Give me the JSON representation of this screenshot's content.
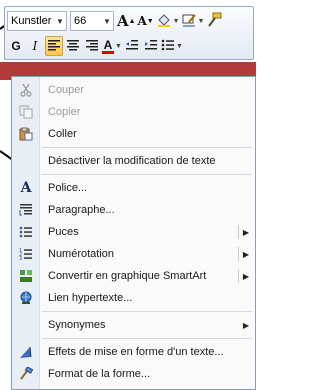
{
  "toolbar": {
    "font_name": "Kunstler",
    "font_size": "66",
    "grow_font": "A",
    "shrink_font": "A",
    "bold": "G",
    "italic": "I",
    "font_color_label": "A"
  },
  "menu": {
    "items": [
      {
        "label": "Couper",
        "icon": "scissors-icon",
        "disabled": true
      },
      {
        "label": "Copier",
        "icon": "copy-icon",
        "disabled": true
      },
      {
        "label": "Coller",
        "icon": "paste-icon",
        "disabled": false
      },
      {
        "label": "Désactiver la modification de texte",
        "icon": "",
        "disabled": false
      },
      {
        "label": "Police...",
        "icon": "font-icon",
        "disabled": false
      },
      {
        "label": "Paragraphe...",
        "icon": "paragraph-icon",
        "disabled": false
      },
      {
        "label": "Puces",
        "icon": "bullets-icon",
        "disabled": false,
        "submenu": true
      },
      {
        "label": "Numérotation",
        "icon": "numbering-icon",
        "disabled": false,
        "submenu": true
      },
      {
        "label": "Convertir en graphique SmartArt",
        "icon": "smartart-icon",
        "disabled": false,
        "submenu": true
      },
      {
        "label": "Lien hypertexte...",
        "icon": "hyperlink-icon",
        "disabled": false
      },
      {
        "label": "Synonymes",
        "icon": "",
        "disabled": false,
        "submenu": true
      },
      {
        "label": "Effets de mise en forme d'un texte...",
        "icon": "text-effects-icon",
        "disabled": false
      },
      {
        "label": "Format de la forme...",
        "icon": "format-shape-icon",
        "disabled": false
      }
    ]
  }
}
